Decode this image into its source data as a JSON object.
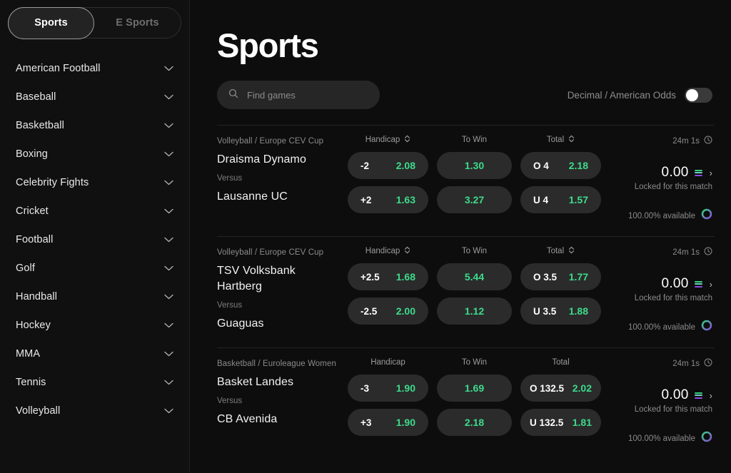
{
  "sidebar": {
    "tabs": [
      {
        "label": "Sports",
        "active": true
      },
      {
        "label": "E Sports",
        "active": false
      }
    ],
    "categories": [
      {
        "label": "American Football"
      },
      {
        "label": "Baseball"
      },
      {
        "label": "Basketball"
      },
      {
        "label": "Boxing"
      },
      {
        "label": "Celebrity Fights"
      },
      {
        "label": "Cricket"
      },
      {
        "label": "Football"
      },
      {
        "label": "Golf"
      },
      {
        "label": "Handball"
      },
      {
        "label": "Hockey"
      },
      {
        "label": "MMA"
      },
      {
        "label": "Tennis"
      },
      {
        "label": "Volleyball"
      }
    ]
  },
  "main": {
    "title": "Sports",
    "search": {
      "placeholder": "Find games",
      "value": "",
      "icon": "search-icon"
    },
    "odds_toggle": {
      "label": "Decimal / American Odds",
      "on": false
    }
  },
  "matches": [
    {
      "league": "Volleyball / Europe CEV Cup",
      "team_home": "Draisma Dynamo",
      "versus": "Versus",
      "team_away": "Lausanne UC",
      "markets": {
        "handicap": {
          "label": "Handicap",
          "sortable": true,
          "home": {
            "line": "-2",
            "odd": "2.08"
          },
          "away": {
            "line": "+2",
            "odd": "1.63"
          }
        },
        "to_win": {
          "label": "To Win",
          "sortable": false,
          "home": {
            "odd": "1.30"
          },
          "away": {
            "odd": "3.27"
          }
        },
        "total": {
          "label": "Total",
          "sortable": true,
          "home": {
            "line": "O 4",
            "odd": "2.18"
          },
          "away": {
            "line": "U 4",
            "odd": "1.57"
          }
        }
      },
      "timer": "24m 1s",
      "stake": "0.00",
      "locked_text": "Locked for this match",
      "available_text": "100.00% available"
    },
    {
      "league": "Volleyball / Europe CEV Cup",
      "team_home": "TSV Volksbank Hartberg",
      "versus": "Versus",
      "team_away": "Guaguas",
      "markets": {
        "handicap": {
          "label": "Handicap",
          "sortable": true,
          "home": {
            "line": "+2.5",
            "odd": "1.68"
          },
          "away": {
            "line": "-2.5",
            "odd": "2.00"
          }
        },
        "to_win": {
          "label": "To Win",
          "sortable": false,
          "home": {
            "odd": "5.44"
          },
          "away": {
            "odd": "1.12"
          }
        },
        "total": {
          "label": "Total",
          "sortable": true,
          "home": {
            "line": "O 3.5",
            "odd": "1.77"
          },
          "away": {
            "line": "U 3.5",
            "odd": "1.88"
          }
        }
      },
      "timer": "24m 1s",
      "stake": "0.00",
      "locked_text": "Locked for this match",
      "available_text": "100.00% available"
    },
    {
      "league": "Basketball / Euroleague Women",
      "team_home": "Basket Landes",
      "versus": "Versus",
      "team_away": "CB Avenida",
      "markets": {
        "handicap": {
          "label": "Handicap",
          "sortable": false,
          "home": {
            "line": "-3",
            "odd": "1.90"
          },
          "away": {
            "line": "+3",
            "odd": "1.90"
          }
        },
        "to_win": {
          "label": "To Win",
          "sortable": false,
          "home": {
            "odd": "1.69"
          },
          "away": {
            "odd": "2.18"
          }
        },
        "total": {
          "label": "Total",
          "sortable": false,
          "home": {
            "line": "O 132.5",
            "odd": "2.02"
          },
          "away": {
            "line": "U 132.5",
            "odd": "1.81"
          }
        }
      },
      "timer": "24m 1s",
      "stake": "0.00",
      "locked_text": "Locked for this match",
      "available_text": "100.00% available"
    }
  ],
  "colors": {
    "background": "#0d0d0d",
    "sidebar": "#101010",
    "pill": "#2b2b2b",
    "odd_green": "#3ddb8c",
    "muted": "#8b8b8b",
    "ring_gradient_start": "#35d07f",
    "ring_gradient_end": "#8a4ce0"
  }
}
